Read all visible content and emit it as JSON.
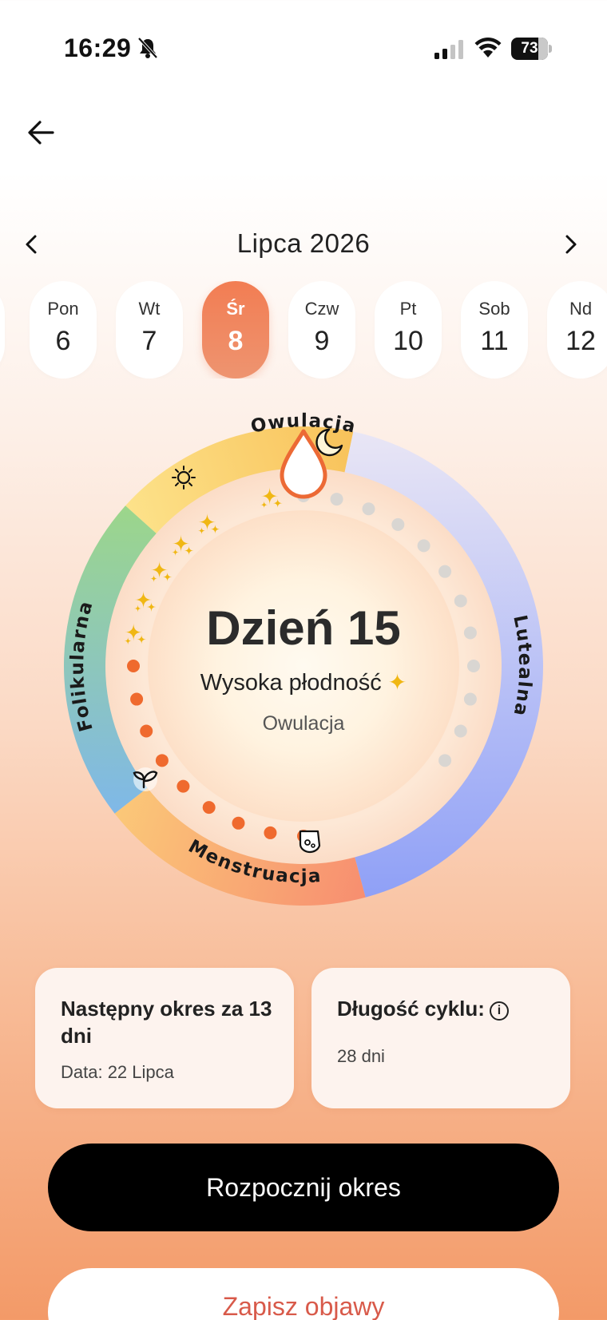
{
  "status_bar": {
    "time": "16:29",
    "battery": "73",
    "icons": [
      "bell-slash-icon",
      "cellular-signal-icon",
      "wifi-icon",
      "battery-icon"
    ]
  },
  "navigation": {
    "back_icon": "arrow-left-icon"
  },
  "calendar": {
    "month_label": "Lipca 2026",
    "prev_icon": "chevron-left-icon",
    "next_icon": "chevron-right-icon",
    "days": [
      {
        "name": "Pon",
        "number": "6",
        "selected": false
      },
      {
        "name": "Wt",
        "number": "7",
        "selected": false
      },
      {
        "name": "Śr",
        "number": "8",
        "selected": true
      },
      {
        "name": "Czw",
        "number": "9",
        "selected": false
      },
      {
        "name": "Pt",
        "number": "10",
        "selected": false
      },
      {
        "name": "Sob",
        "number": "11",
        "selected": false
      },
      {
        "name": "Nd",
        "number": "12",
        "selected": false
      }
    ]
  },
  "cycle": {
    "day_label": "Dzień 15",
    "fertility_label": "Wysoka płodność",
    "fertility_icon": "sparkles-icon",
    "current_phase": "Owulacja",
    "cycle_length_days": 28,
    "current_day": 15,
    "phases": [
      {
        "name": "Owulacja",
        "color": "#f8d06a",
        "icons": [
          "sun-icon",
          "moon-icon"
        ]
      },
      {
        "name": "Lutealna",
        "color": "#9aa6f7"
      },
      {
        "name": "Menstruacja",
        "color": "#f79a74",
        "icons": [
          "sprout-icon",
          "uterus-icon"
        ]
      },
      {
        "name": "Folikularna",
        "color": "#8fd08a"
      }
    ],
    "colors": {
      "past_dot": "#ef6a2e",
      "future_dot": "#d9d6d2",
      "sparkle": "#f0b713",
      "drop_marker": "#ec6a35"
    }
  },
  "cards": {
    "next_period": {
      "title": "Następny okres za 13 dni",
      "subtitle": "Data: 22 Lipca"
    },
    "cycle_length": {
      "title": "Długość cyklu:",
      "info_icon": "info-icon",
      "value": "28 dni"
    }
  },
  "actions": {
    "start_period": "Rozpocznij okres",
    "log_symptoms": "Zapisz objawy"
  }
}
